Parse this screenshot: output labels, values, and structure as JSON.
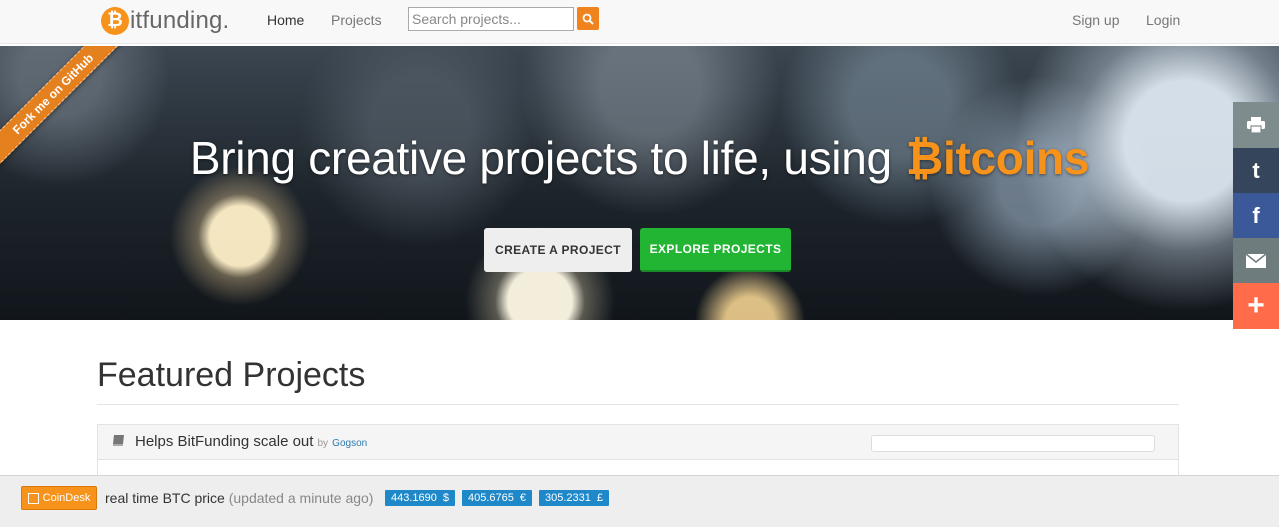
{
  "navbar": {
    "brand_letter": "₿",
    "brand_text": "itfunding.",
    "home": "Home",
    "projects": "Projects",
    "search_placeholder": "Search projects...",
    "signup": "Sign up",
    "login": "Login"
  },
  "ribbon": "Fork me on GitHub",
  "hero": {
    "title": "Bring creative projects to life, using",
    "title_accent": "₿itcoins",
    "create_button": "CREATE A PROJECT",
    "explore_button": "EXPLORE PROJECTS"
  },
  "share": {
    "icons": [
      "print-icon",
      "tumblr-icon",
      "facebook-icon",
      "email-icon",
      "plus-icon"
    ]
  },
  "featured": {
    "title": "Featured Projects",
    "projects": [
      {
        "name": "Helps BitFunding scale out",
        "by": "by",
        "author": "Gogson"
      }
    ]
  },
  "ticker": {
    "coindesk": "CoinDesk",
    "label": "real time BTC price",
    "updated": "(updated a minute ago)",
    "prices": [
      {
        "value": "443.1690",
        "symbol": "$"
      },
      {
        "value": "405.6765",
        "symbol": "€"
      },
      {
        "value": "305.2331",
        "symbol": "£"
      }
    ]
  },
  "colors": {
    "accent": "#f7931a",
    "explore_green": "#22b534",
    "price_blue": "#1e88c8"
  }
}
